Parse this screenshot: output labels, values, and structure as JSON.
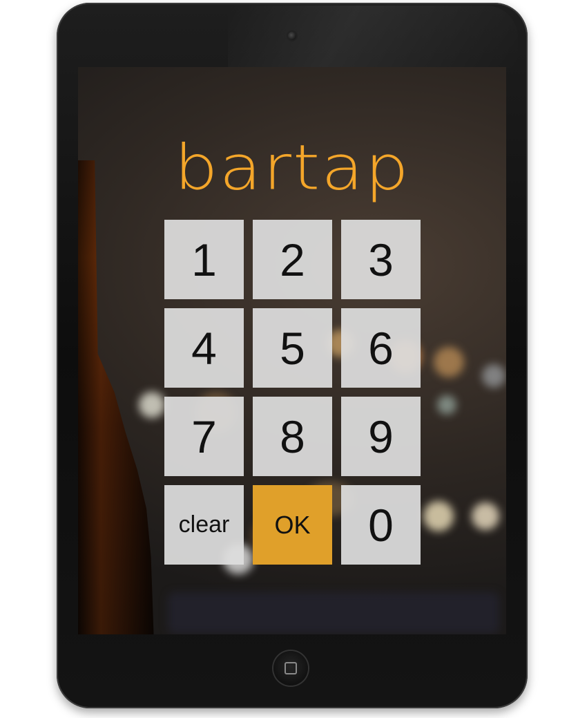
{
  "app": {
    "logo_text": "bartap"
  },
  "keypad": {
    "keys": [
      {
        "label": "1"
      },
      {
        "label": "2"
      },
      {
        "label": "3"
      },
      {
        "label": "4"
      },
      {
        "label": "5"
      },
      {
        "label": "6"
      },
      {
        "label": "7"
      },
      {
        "label": "8"
      },
      {
        "label": "9"
      },
      {
        "label": "clear"
      },
      {
        "label": "OK"
      },
      {
        "label": "0"
      }
    ]
  },
  "colors": {
    "accent": "#f4a62a",
    "ok_button": "#e0a02a",
    "key_background": "#dedede"
  },
  "icons": {
    "home_button": "home-button-icon",
    "camera": "camera-icon"
  }
}
